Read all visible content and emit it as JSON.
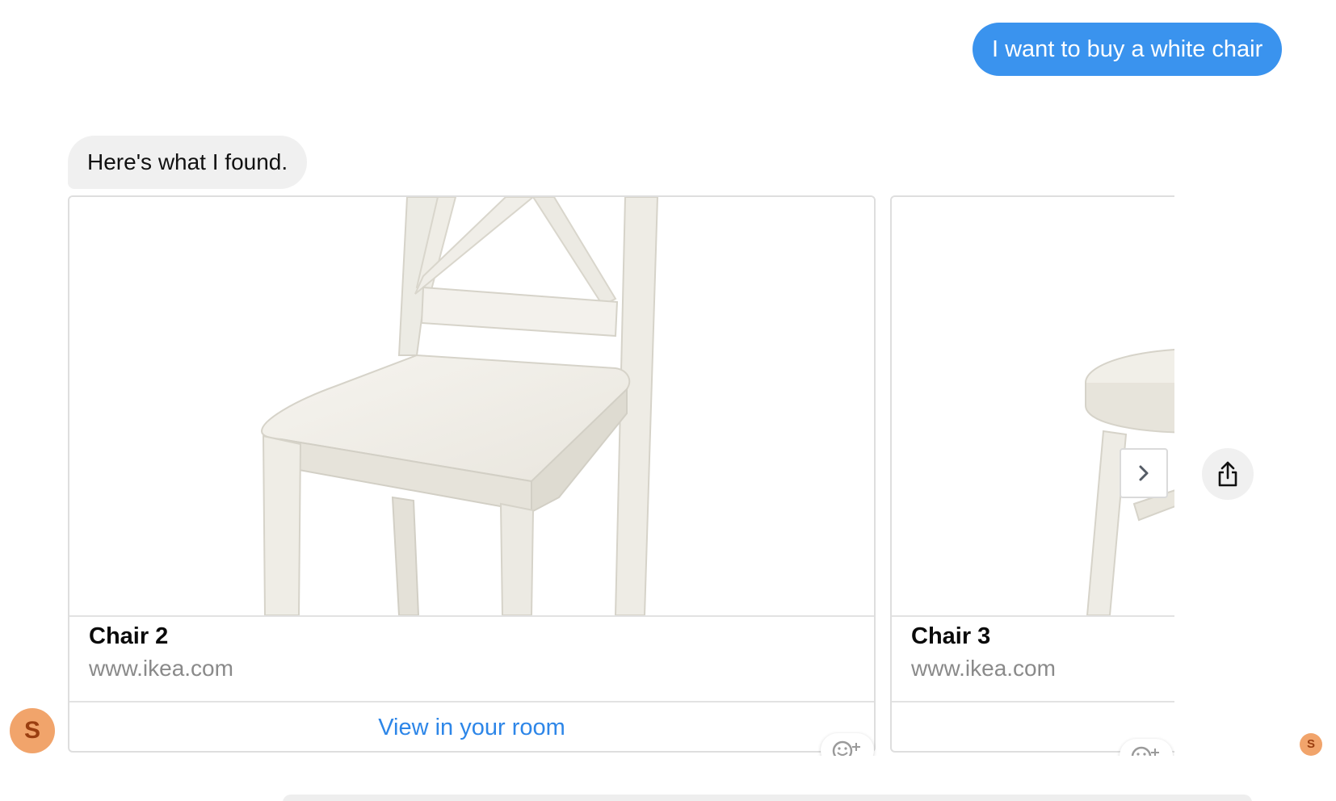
{
  "conversation": {
    "user_message": "I want to buy a white chair",
    "bot_message": "Here's what I found."
  },
  "carousel": {
    "cards": [
      {
        "title": "Chair 2",
        "url": "www.ikea.com",
        "action_label": "View in your room",
        "image_icon": "white-wooden-chair-image"
      },
      {
        "title": "Chair 3",
        "url": "www.ikea.com",
        "action_label": "",
        "image_icon": "white-round-stool-image"
      }
    ],
    "next_icon": "chevron-right-icon",
    "share_icon": "share-icon",
    "reaction_icon": "add-reaction-icon"
  },
  "avatars": {
    "participant_initial": "S",
    "read_receipt_initial": "S"
  },
  "colors": {
    "user_bubble": "#3a93ee",
    "bot_bubble": "#f0f0f0",
    "link": "#2d86e8",
    "avatar": "#f1a46b"
  }
}
